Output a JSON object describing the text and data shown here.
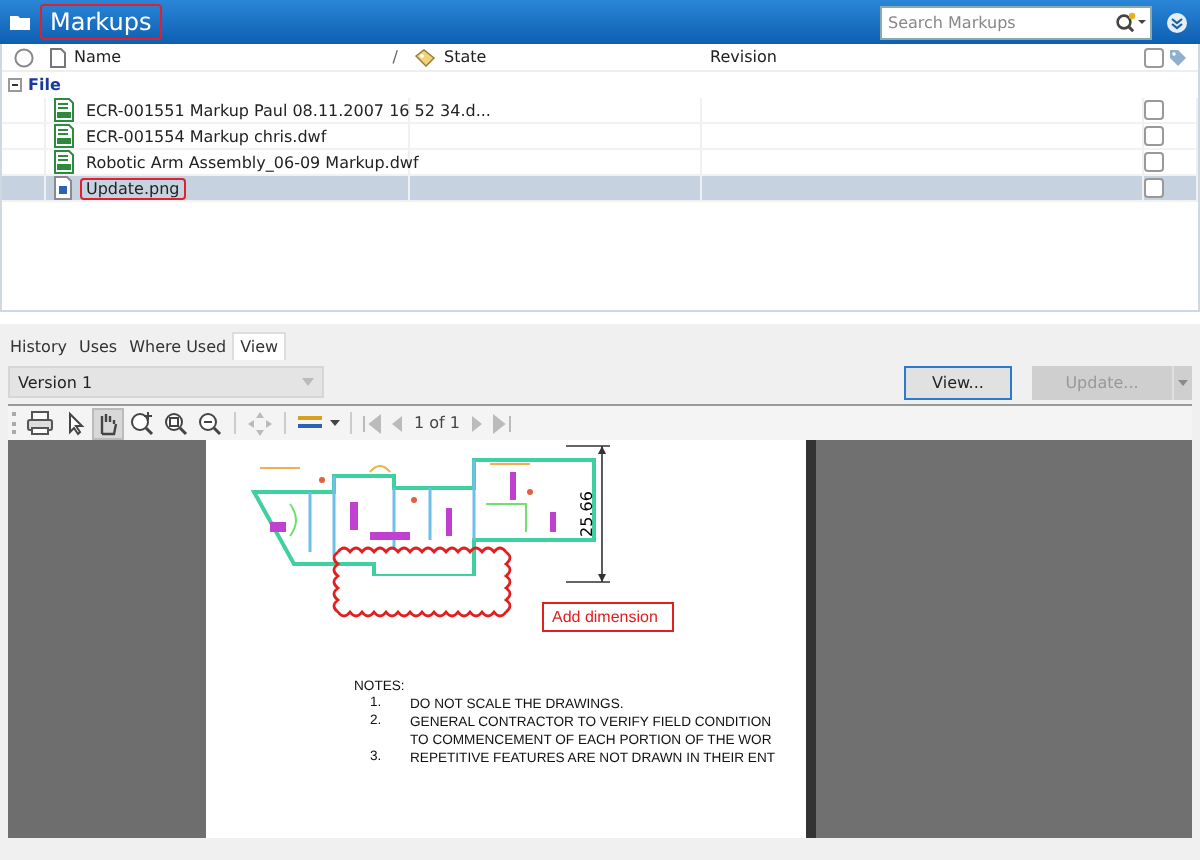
{
  "header": {
    "title": "Markups",
    "title_highlighted": true,
    "search": {
      "placeholder": "Search Markups"
    }
  },
  "select_all": {
    "checked": false
  },
  "columns": [
    {
      "label": "Name",
      "sort_mark": "/"
    },
    {
      "label": "State"
    },
    {
      "label": "Revision"
    }
  ],
  "groups": [
    {
      "label": "File",
      "expanded": true,
      "rows": [
        {
          "name": "ECR-001551 Markup Paul 08.11.2007 16 52 34.d...",
          "kind": "dwf",
          "selected": false,
          "checked": false,
          "highlighted": false
        },
        {
          "name": "ECR-001554 Markup chris.dwf",
          "kind": "dwf",
          "selected": false,
          "checked": false,
          "highlighted": false
        },
        {
          "name": "Robotic Arm Assembly_06-09 Markup.dwf",
          "kind": "dwf",
          "selected": false,
          "checked": false,
          "highlighted": false
        },
        {
          "name": "Update.png",
          "kind": "png",
          "selected": true,
          "checked": false,
          "highlighted": true
        }
      ]
    }
  ],
  "tabs": [
    {
      "label": "History",
      "selected": false
    },
    {
      "label": "Uses",
      "selected": false
    },
    {
      "label": "Where Used",
      "selected": false
    },
    {
      "label": "View",
      "selected": true
    }
  ],
  "version": {
    "value": "Version 1"
  },
  "buttons": [
    {
      "label": "View...",
      "disabled": false,
      "focused": true
    },
    {
      "label": "Update...",
      "disabled": true,
      "focused": false
    }
  ],
  "toolbar": {
    "page_indicator": "1 of 1"
  },
  "document": {
    "dimension": "25.66",
    "callout": "Add dimension",
    "notes_title": "NOTES:",
    "notes": [
      {
        "number": "1.",
        "lines": [
          "DO NOT SCALE THE DRAWINGS."
        ]
      },
      {
        "number": "2.",
        "lines": [
          "GENERAL CONTRACTOR TO VERIFY FIELD CONDITION",
          "TO COMMENCEMENT OF EACH PORTION OF THE WOR"
        ]
      },
      {
        "number": "3.",
        "lines": [
          "REPETITIVE FEATURES ARE NOT DRAWN IN THEIR ENT"
        ]
      }
    ]
  }
}
